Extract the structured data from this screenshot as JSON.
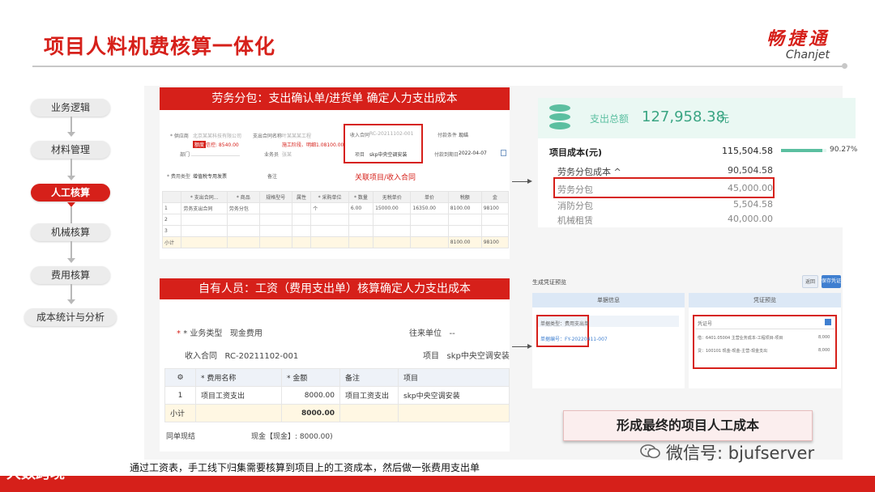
{
  "slide": {
    "title": "项目人料机费核算一体化",
    "caption": "通过工资表，手工线下归集需要核算到项目上的工资成本，然后做一张费用支出单"
  },
  "logo": {
    "cn": "畅捷通",
    "en": "Chanjet"
  },
  "flow": {
    "steps": [
      "业务逻辑",
      "材料管理",
      "人工核算",
      "机械核算",
      "费用核算",
      "成本统计与分析"
    ],
    "active_index": 2
  },
  "subcontract": {
    "banner": "劳务分包：支出确认单/进货单 确定人力支出成本",
    "fields": {
      "supplier_label": "* 供应商",
      "supplier_value": "北京某某科技有限公司",
      "credit_tag": "额度",
      "credit_value": "信控: 8540.00",
      "dept_label": "部门",
      "contract_label": "支出合同名称",
      "contract_value": "叶某某某工程",
      "contract_sub": "施工阶段、明细1.08100.00",
      "salesman_label": "业务员",
      "salesman_value": "张某",
      "income_contract_label": "收入合同",
      "income_contract_value": "RC-20211102-001",
      "project_label": "项目",
      "project_value": "skp中央空调安装",
      "pay_cond_label": "付款条件",
      "pay_cond_value": "现结",
      "pay_date_label": "付款到期日",
      "pay_date_value": "2022-04-07",
      "fee_type_label": "* 费用类型",
      "fee_type_value": "增值税专用发票",
      "remark_label": "备注",
      "link_note": "关联项目/收入合同"
    },
    "table": {
      "headers": [
        "",
        "* 支出合同...",
        "* 商品",
        "规格型号",
        "属性",
        "* 采购单位",
        "* 数量",
        "无税单价",
        "单价",
        "税额",
        "金"
      ],
      "rows": [
        [
          "1",
          "劳务支出合同",
          "劳务分包",
          "",
          "",
          "个",
          "6.00",
          "15000.00",
          "16350.00",
          "8100.00",
          "98100"
        ],
        [
          "2",
          "",
          "",
          "",
          "",
          "",
          "",
          "",
          "",
          "",
          ""
        ],
        [
          "3",
          "",
          "",
          "",
          "",
          "",
          "",
          "",
          "",
          "",
          ""
        ]
      ],
      "total_label": "小计",
      "total_tax": "8100.00",
      "total_amount": "98100"
    }
  },
  "cost_summary": {
    "total_label": "支出总额",
    "total_value": "127,958.38",
    "total_unit": "元",
    "project_cost_label": "项目成本(元)",
    "project_cost_value": "115,504.58",
    "project_cost_percent": "90.27%",
    "project_cost_fraction": 0.9027,
    "rows": [
      {
        "label": "劳务分包成本 ^",
        "value": "90,504.58"
      },
      {
        "label": "劳务分包",
        "value": "45,000.00"
      },
      {
        "label": "消防分包",
        "value": "5,504.58"
      },
      {
        "label": "机械租赁",
        "value": "40,000.00"
      }
    ]
  },
  "own_staff": {
    "banner": "自有人员：工资（费用支出单）核算确定人力支出成本",
    "biz_type_label": "* 业务类型",
    "biz_type_value": "现金费用",
    "partner_label": "往来单位",
    "partner_value": "--",
    "income_contract_label": "收入合同",
    "income_contract_value": "RC-20211102-001",
    "project_label": "项目",
    "project_value": "skp中央空调安装",
    "table": {
      "headers": [
        "⚙",
        "* 费用名称",
        "* 金额",
        "备注",
        "项目"
      ],
      "rows": [
        [
          "1",
          "项目工资支出",
          "8000.00",
          "项目工资支出",
          "skp中央空调安装"
        ]
      ],
      "total_label": "小计",
      "total_amount": "8000.00"
    },
    "settle_label": "同单现结",
    "settle_value": "现金【现金】: 8000.00)"
  },
  "voucher": {
    "title": "生成凭证预览",
    "btn_back": "返回",
    "btn_save": "保存凭证",
    "col_left": "单据信息",
    "col_right": "凭证预览",
    "left_line1": "单据类型：费用支出单",
    "left_line2": "单据编号：FY-20220411-007",
    "right_header": "凭证号",
    "right_line1": "借：6401.05004 主营业务成本-工程项目-项目",
    "right_line1_amt": "8,000",
    "right_line2": "贷：100101 现金-现金-主营-现金支出",
    "right_line2_amt": "8,000"
  },
  "result_button": "形成最终的项目人工成本",
  "wechat": "微信号: bjufserver",
  "watermark": "大数跨境"
}
